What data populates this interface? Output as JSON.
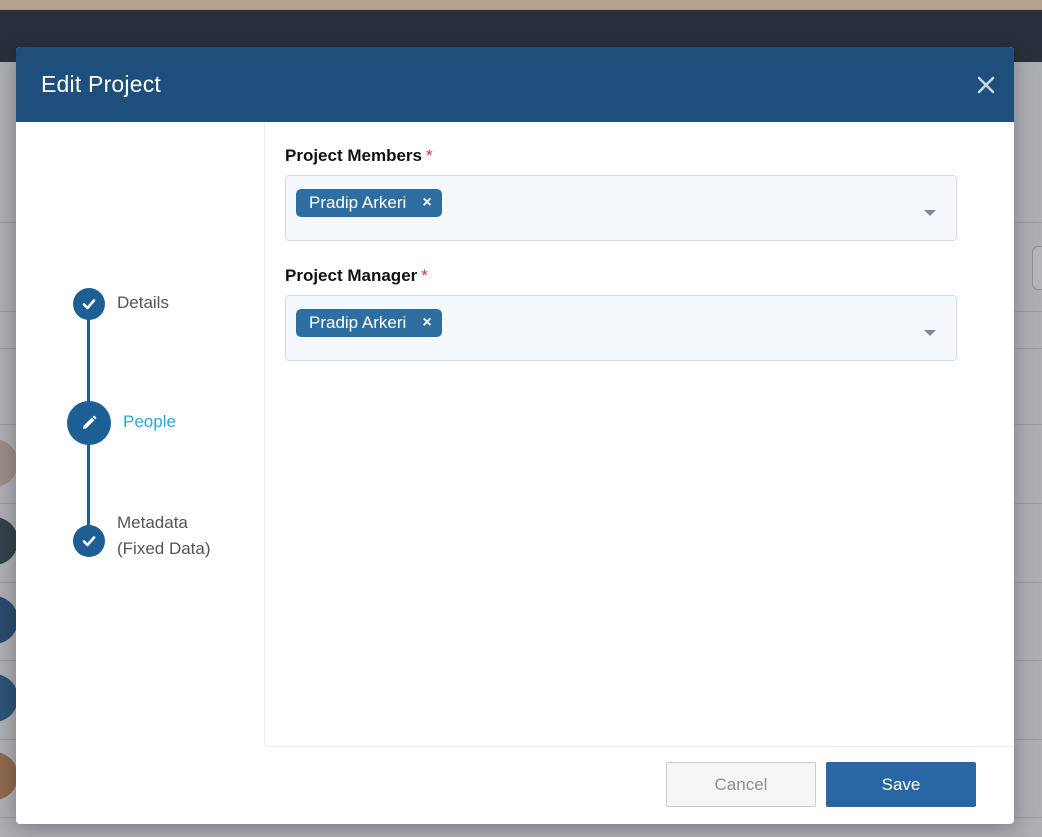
{
  "modal": {
    "title": "Edit Project"
  },
  "steps": [
    {
      "label": "Details",
      "state": "complete",
      "icon": "check-icon"
    },
    {
      "label": "People",
      "state": "active",
      "icon": "pencil-icon"
    },
    {
      "label_line1": "Metadata",
      "label_line2": "(Fixed Data)",
      "state": "complete",
      "icon": "check-icon"
    }
  ],
  "fields": {
    "members": {
      "label": "Project Members",
      "required_mark": "*",
      "tags": [
        "Pradip Arkeri"
      ],
      "remove_glyph": "×"
    },
    "manager": {
      "label": "Project Manager",
      "required_mark": "*",
      "tags": [
        "Pradip Arkeri"
      ],
      "remove_glyph": "×"
    }
  },
  "footer": {
    "cancel_label": "Cancel",
    "save_label": "Save"
  },
  "colors": {
    "header": "#1d4e7c",
    "accent": "#1d5f94",
    "active_step": "#2aa7d9",
    "tag": "#2f6ea0",
    "required": "#d9342b"
  }
}
